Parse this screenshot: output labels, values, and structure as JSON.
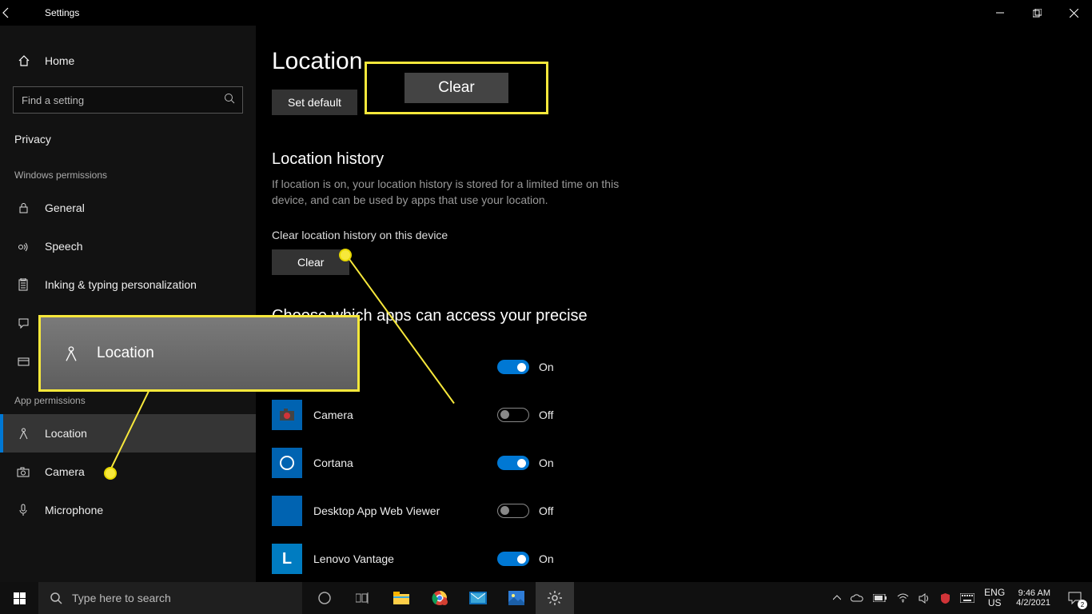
{
  "window": {
    "title": "Settings",
    "controls": {
      "min": "—",
      "max": "❐",
      "close": "✕"
    }
  },
  "sidebar": {
    "home_label": "Home",
    "search_placeholder": "Find a setting",
    "section": "Privacy",
    "group_windows": "Windows permissions",
    "items_windows": [
      {
        "icon": "lock",
        "label": "General"
      },
      {
        "icon": "speech",
        "label": "Speech"
      },
      {
        "icon": "inking",
        "label": "Inking & typing personalization"
      },
      {
        "icon": "diag",
        "label": ""
      },
      {
        "icon": "activity",
        "label": ""
      }
    ],
    "group_app": "App permissions",
    "items_app": [
      {
        "icon": "location",
        "label": "Location",
        "selected": true
      },
      {
        "icon": "camera",
        "label": "Camera"
      },
      {
        "icon": "mic",
        "label": "Microphone"
      }
    ]
  },
  "main": {
    "title": "Location",
    "set_default": "Set default",
    "history_heading": "Location history",
    "history_desc": "If location is on, your location history is stored for a limited time on this device, and can be used by apps that use your location.",
    "clear_label_line": "Clear location history on this device",
    "clear_btn": "Clear",
    "choose_heading": "Choose which apps can access your precise",
    "apps": [
      {
        "name": "",
        "state": "On",
        "on": true,
        "color": "#0063b1"
      },
      {
        "name": "Camera",
        "state": "Off",
        "on": false,
        "color": "#0063b1"
      },
      {
        "name": "Cortana",
        "state": "On",
        "on": true,
        "color": "#0063b1"
      },
      {
        "name": "Desktop App Web Viewer",
        "state": "Off",
        "on": false,
        "color": "#0063b1"
      },
      {
        "name": "Lenovo Vantage",
        "state": "On",
        "on": true,
        "color": "#007cc1"
      }
    ]
  },
  "callouts": {
    "clear_zoom": "Clear",
    "location_zoom": "Location"
  },
  "taskbar": {
    "search_placeholder": "Type here to search",
    "lang1": "ENG",
    "lang2": "US",
    "time": "9:46 AM",
    "date": "4/2/2021",
    "notif_count": "2"
  }
}
